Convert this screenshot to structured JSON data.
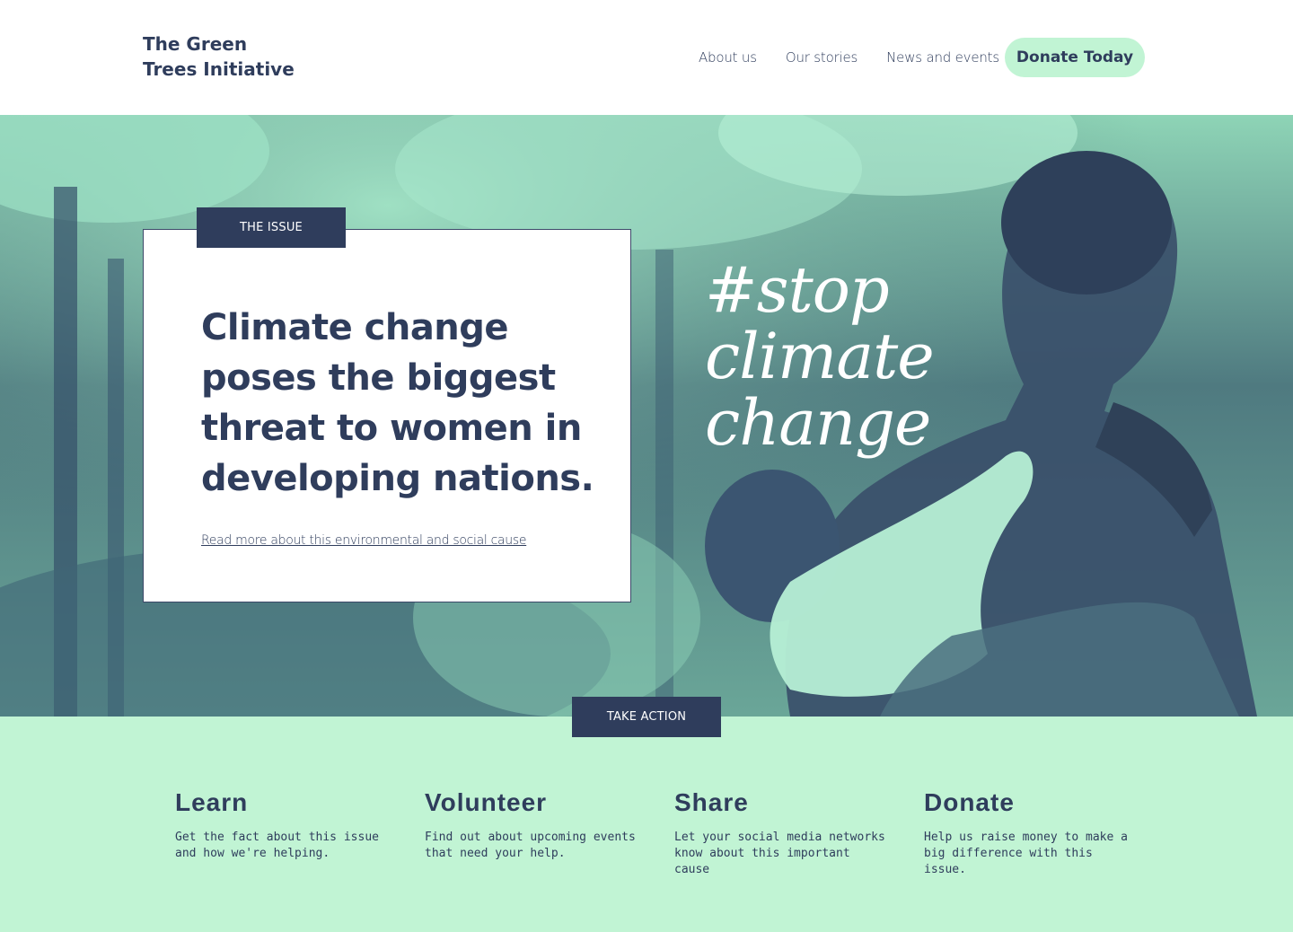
{
  "header": {
    "logo_line1": "The Green",
    "logo_line2": "Trees Initiative",
    "nav": [
      {
        "label": "About us"
      },
      {
        "label": "Our stories"
      },
      {
        "label": "News and events"
      }
    ],
    "donate_label": "Donate Today"
  },
  "hero": {
    "hashtag_line1": "#stop",
    "hashtag_line2": "climate",
    "hashtag_line3": "change",
    "card": {
      "tag": "THE ISSUE",
      "title": "Climate change poses the biggest threat to women in developing nations.",
      "link": "Read more about this environmental and social cause"
    }
  },
  "action": {
    "tag": "TAKE ACTION",
    "columns": [
      {
        "title": "Learn",
        "text": "Get the fact about this issue and how we're helping."
      },
      {
        "title": "Volunteer",
        "text": "Find out about upcoming events that need your help."
      },
      {
        "title": "Share",
        "text": "Let your social media networks know about this important cause"
      },
      {
        "title": "Donate",
        "text": "Help us raise money to make a big difference with this issue."
      }
    ]
  },
  "colors": {
    "navy": "#2f3d5c",
    "mint": "#c1f4d4",
    "white": "#ffffff"
  }
}
